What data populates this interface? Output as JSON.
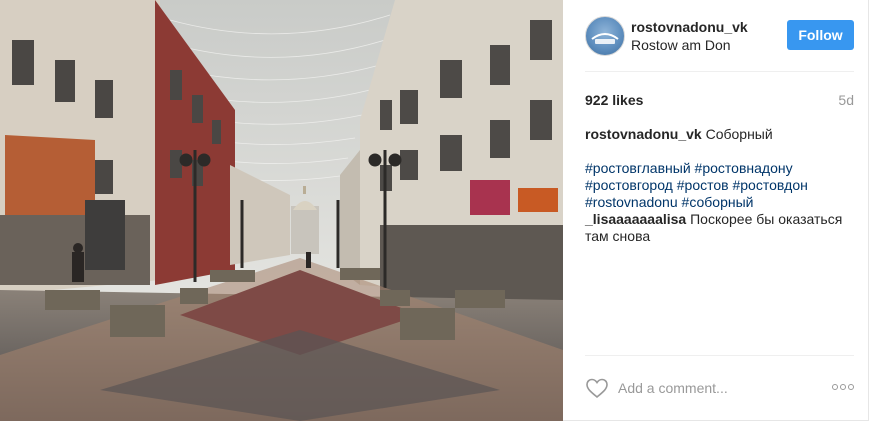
{
  "post": {
    "image_alt": "Photo of a pedestrian street in Rostov-on-Don with a cathedral at the end",
    "header": {
      "username": "rostovnadonu_vk",
      "location": "Rostow am Don",
      "follow_label": "Follow",
      "avatar_icon": "avatar-logo-icon"
    },
    "stats": {
      "likes": "922 likes",
      "age": "5d"
    },
    "caption": {
      "username": "rostovnadonu_vk",
      "text": " Соборный",
      "hashtags": [
        "#ростовглавный",
        "#ростовнадону",
        "#ростовгород",
        "#ростов",
        "#ростовдон",
        "#rostovnadonu",
        "#соборный"
      ]
    },
    "comments": [
      {
        "username": "_lisaaaaaaalisa",
        "text": " Поскорее бы оказаться там снова"
      }
    ],
    "actions": {
      "like_icon": "heart-icon",
      "comment_placeholder": "Add a comment...",
      "more_icon": "more-options-icon"
    },
    "colors": {
      "follow_button": "#3897f0",
      "hashtag": "#003569",
      "muted": "#999999"
    }
  }
}
